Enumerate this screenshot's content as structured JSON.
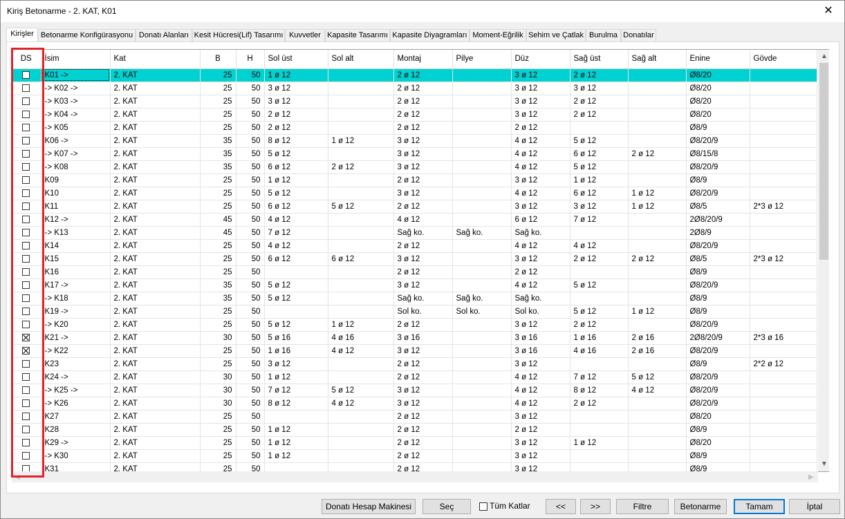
{
  "window": {
    "title": "Kiriş Betonarme - 2. KAT, K01",
    "close_label": "✕"
  },
  "tabs": [
    {
      "label": "Kirişler"
    },
    {
      "label": "Betonarme Konfigürasyonu"
    },
    {
      "label": "Donatı Alanları"
    },
    {
      "label": "Kesit Hücresi(Lif) Tasarımı"
    },
    {
      "label": "Kuvvetler"
    },
    {
      "label": "Kapasite Tasarımı"
    },
    {
      "label": "Kapasite Diyagramları"
    },
    {
      "label": "Moment-Eğrilik"
    },
    {
      "label": "Sehim ve Çatlak"
    },
    {
      "label": "Burulma"
    },
    {
      "label": "Donatılar"
    }
  ],
  "table": {
    "columns": [
      "DS",
      "İsim",
      "Kat",
      "B",
      "H",
      "Sol üst",
      "Sol alt",
      "Montaj",
      "Pilye",
      "Düz",
      "Sağ üst",
      "Sağ alt",
      "Enine",
      "Gövde"
    ],
    "rows": [
      {
        "ds": false,
        "cells": [
          "K01 ->",
          "2. KAT",
          "25",
          "50",
          "1 ø 12",
          "",
          "2 ø 12",
          "",
          "3 ø 12",
          "2 ø 12",
          "",
          "Ø8/20",
          ""
        ]
      },
      {
        "ds": false,
        "cells": [
          "-> K02 ->",
          "2. KAT",
          "25",
          "50",
          "3 ø 12",
          "",
          "2 ø 12",
          "",
          "3 ø 12",
          "3 ø 12",
          "",
          "Ø8/20",
          ""
        ]
      },
      {
        "ds": false,
        "cells": [
          "-> K03 ->",
          "2. KAT",
          "25",
          "50",
          "3 ø 12",
          "",
          "2 ø 12",
          "",
          "3 ø 12",
          "2 ø 12",
          "",
          "Ø8/20",
          ""
        ]
      },
      {
        "ds": false,
        "cells": [
          "-> K04 ->",
          "2. KAT",
          "25",
          "50",
          "2 ø 12",
          "",
          "2 ø 12",
          "",
          "3 ø 12",
          "2 ø 12",
          "",
          "Ø8/20",
          ""
        ]
      },
      {
        "ds": false,
        "cells": [
          "-> K05",
          "2. KAT",
          "25",
          "50",
          "2 ø 12",
          "",
          "2 ø 12",
          "",
          "2 ø 12",
          "",
          "",
          "Ø8/9",
          ""
        ]
      },
      {
        "ds": false,
        "cells": [
          "K06 ->",
          "2. KAT",
          "35",
          "50",
          "8 ø 12",
          "1 ø 12",
          "3 ø 12",
          "",
          "4 ø 12",
          "5 ø 12",
          "",
          "Ø8/20/9",
          ""
        ]
      },
      {
        "ds": false,
        "cells": [
          "-> K07 ->",
          "2. KAT",
          "35",
          "50",
          "5 ø 12",
          "",
          "3 ø 12",
          "",
          "4 ø 12",
          "6 ø 12",
          "2 ø 12",
          "Ø8/15/8",
          ""
        ]
      },
      {
        "ds": false,
        "cells": [
          "-> K08",
          "2. KAT",
          "35",
          "50",
          "6 ø 12",
          "2 ø 12",
          "3 ø 12",
          "",
          "4 ø 12",
          "5 ø 12",
          "",
          "Ø8/20/9",
          ""
        ]
      },
      {
        "ds": false,
        "cells": [
          "K09",
          "2. KAT",
          "25",
          "50",
          "1 ø 12",
          "",
          "2 ø 12",
          "",
          "3 ø 12",
          "1 ø 12",
          "",
          "Ø8/9",
          ""
        ]
      },
      {
        "ds": false,
        "cells": [
          "K10",
          "2. KAT",
          "25",
          "50",
          "5 ø 12",
          "",
          "3 ø 12",
          "",
          "4 ø 12",
          "6 ø 12",
          "1 ø 12",
          "Ø8/20/9",
          ""
        ]
      },
      {
        "ds": false,
        "cells": [
          "K11",
          "2. KAT",
          "25",
          "50",
          "6 ø 12",
          "5 ø 12",
          "2 ø 12",
          "",
          "3 ø 12",
          "3 ø 12",
          "1 ø 12",
          "Ø8/5",
          "2*3 ø 12"
        ]
      },
      {
        "ds": false,
        "cells": [
          "K12 ->",
          "2. KAT",
          "45",
          "50",
          "4 ø 12",
          "",
          "4 ø 12",
          "",
          "6 ø 12",
          "7 ø 12",
          "",
          "2Ø8/20/9",
          ""
        ]
      },
      {
        "ds": false,
        "cells": [
          "-> K13",
          "2. KAT",
          "45",
          "50",
          "7 ø 12",
          "",
          "Sağ ko.",
          "Sağ ko.",
          "Sağ ko.",
          "",
          "",
          "2Ø8/9",
          ""
        ]
      },
      {
        "ds": false,
        "cells": [
          "K14",
          "2. KAT",
          "25",
          "50",
          "4 ø 12",
          "",
          "2 ø 12",
          "",
          "4 ø 12",
          "4 ø 12",
          "",
          "Ø8/20/9",
          ""
        ]
      },
      {
        "ds": false,
        "cells": [
          "K15",
          "2. KAT",
          "25",
          "50",
          "6 ø 12",
          "6 ø 12",
          "3 ø 12",
          "",
          "3 ø 12",
          "2 ø 12",
          "2 ø 12",
          "Ø8/5",
          "2*3 ø 12"
        ]
      },
      {
        "ds": false,
        "cells": [
          "K16",
          "2. KAT",
          "25",
          "50",
          "",
          "",
          "2 ø 12",
          "",
          "2 ø 12",
          "",
          "",
          "Ø8/9",
          ""
        ]
      },
      {
        "ds": false,
        "cells": [
          "K17 ->",
          "2. KAT",
          "35",
          "50",
          "5 ø 12",
          "",
          "3 ø 12",
          "",
          "4 ø 12",
          "5 ø 12",
          "",
          "Ø8/20/9",
          ""
        ]
      },
      {
        "ds": false,
        "cells": [
          "-> K18",
          "2. KAT",
          "35",
          "50",
          "5 ø 12",
          "",
          "Sağ ko.",
          "Sağ ko.",
          "Sağ ko.",
          "",
          "",
          "Ø8/9",
          ""
        ]
      },
      {
        "ds": false,
        "cells": [
          "K19 ->",
          "2. KAT",
          "25",
          "50",
          "",
          "",
          "Sol ko.",
          "Sol ko.",
          "Sol ko.",
          "5 ø 12",
          "1 ø 12",
          "Ø8/9",
          ""
        ]
      },
      {
        "ds": false,
        "cells": [
          "-> K20",
          "2. KAT",
          "25",
          "50",
          "5 ø 12",
          "1 ø 12",
          "2 ø 12",
          "",
          "3 ø 12",
          "2 ø 12",
          "",
          "Ø8/20/9",
          ""
        ]
      },
      {
        "ds": true,
        "cells": [
          "K21 ->",
          "2. KAT",
          "30",
          "50",
          "5 ø 16",
          "4 ø 16",
          "3 ø 16",
          "",
          "3 ø 16",
          "1 ø 16",
          "2 ø 16",
          "2Ø8/20/9",
          "2*3 ø 16"
        ]
      },
      {
        "ds": true,
        "cells": [
          "-> K22",
          "2. KAT",
          "25",
          "50",
          "1 ø 16",
          "4 ø 12",
          "3 ø 12",
          "",
          "3 ø 16",
          "4 ø 16",
          "2 ø 16",
          "Ø8/20/9",
          ""
        ]
      },
      {
        "ds": false,
        "cells": [
          "K23",
          "2. KAT",
          "25",
          "50",
          "3 ø 12",
          "",
          "2 ø 12",
          "",
          "3 ø 12",
          "",
          "",
          "Ø8/9",
          "2*2 ø 12"
        ]
      },
      {
        "ds": false,
        "cells": [
          "K24 ->",
          "2. KAT",
          "30",
          "50",
          "1 ø 12",
          "",
          "2 ø 12",
          "",
          "4 ø 12",
          "7 ø 12",
          "5 ø 12",
          "Ø8/20/9",
          ""
        ]
      },
      {
        "ds": false,
        "cells": [
          "-> K25 ->",
          "2. KAT",
          "30",
          "50",
          "7 ø 12",
          "5 ø 12",
          "3 ø 12",
          "",
          "4 ø 12",
          "8 ø 12",
          "4 ø 12",
          "Ø8/20/9",
          ""
        ]
      },
      {
        "ds": false,
        "cells": [
          "-> K26",
          "2. KAT",
          "30",
          "50",
          "8 ø 12",
          "4 ø 12",
          "3 ø 12",
          "",
          "4 ø 12",
          "2 ø 12",
          "",
          "Ø8/20/9",
          ""
        ]
      },
      {
        "ds": false,
        "cells": [
          "K27",
          "2. KAT",
          "25",
          "50",
          "",
          "",
          "2 ø 12",
          "",
          "3 ø 12",
          "",
          "",
          "Ø8/20",
          ""
        ]
      },
      {
        "ds": false,
        "cells": [
          "K28",
          "2. KAT",
          "25",
          "50",
          "1 ø 12",
          "",
          "2 ø 12",
          "",
          "2 ø 12",
          "",
          "",
          "Ø8/9",
          ""
        ]
      },
      {
        "ds": false,
        "cells": [
          "K29 ->",
          "2. KAT",
          "25",
          "50",
          "1 ø 12",
          "",
          "2 ø 12",
          "",
          "3 ø 12",
          "1 ø 12",
          "",
          "Ø8/20",
          ""
        ]
      },
      {
        "ds": false,
        "cells": [
          "-> K30",
          "2. KAT",
          "25",
          "50",
          "1 ø 12",
          "",
          "2 ø 12",
          "",
          "3 ø 12",
          "",
          "",
          "Ø8/9",
          ""
        ]
      },
      {
        "ds": false,
        "cells": [
          "K31",
          "2. KAT",
          "25",
          "50",
          "",
          "",
          "2 ø 12",
          "",
          "3 ø 12",
          "",
          "",
          "Ø8/9",
          ""
        ]
      }
    ]
  },
  "buttons": {
    "calculator": "Donatı Hesap Makinesi",
    "select": "Seç",
    "all_floors": "Tüm Katlar",
    "prev": "<<",
    "next": ">>",
    "filter": "Filtre",
    "concrete": "Betonarme",
    "ok": "Tamam",
    "cancel": "İptal"
  },
  "scroll": {
    "up_icon": "▲",
    "down_icon": "▼",
    "left_icon": "◀",
    "right_icon": "▶"
  },
  "colors": {
    "selected_row": "#00d2d2",
    "highlight_box": "#e2212a",
    "default_button_border": "#0078d7"
  }
}
